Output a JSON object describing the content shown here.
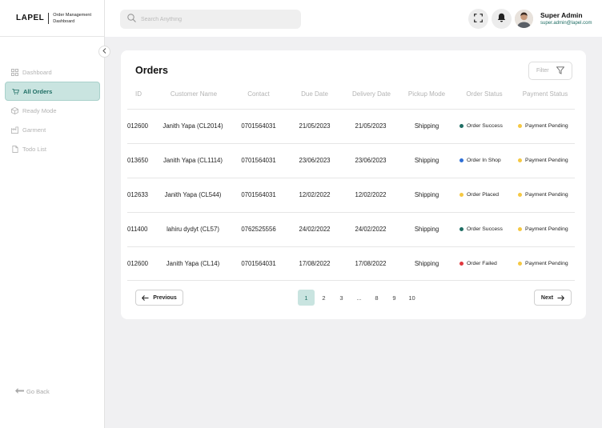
{
  "brand": {
    "name": "LAPEL",
    "subtitle": "Order Management Dashboard"
  },
  "sidebar": {
    "items": [
      {
        "label": "Dashboard",
        "icon": "grid-icon",
        "active": false
      },
      {
        "label": "All Orders",
        "icon": "cart-icon",
        "active": true
      },
      {
        "label": "Ready Mode",
        "icon": "box-icon",
        "active": false
      },
      {
        "label": "Garment",
        "icon": "factory-icon",
        "active": false
      },
      {
        "label": "Todo List",
        "icon": "document-icon",
        "active": false
      }
    ],
    "go_back": "Go Back"
  },
  "topbar": {
    "search_placeholder": "Search Anything",
    "user": {
      "name": "Super Admin",
      "email": "super.admin@lapel.com"
    }
  },
  "orders": {
    "title": "Orders",
    "filter_label": "Filter",
    "columns": [
      "ID",
      "Customer Name",
      "Contact",
      "Due Date",
      "Delivery Date",
      "Pickup Mode",
      "Order Status",
      "Payment Status"
    ],
    "rows": [
      {
        "id": "012600",
        "customer": "Janith Yapa (CL2014)",
        "contact": "0701564031",
        "due": "21/05/2023",
        "delivery": "21/05/2023",
        "pickup": "Shipping",
        "order_status": "Order Success",
        "order_color": "#1f6e64",
        "payment_status": "Payment Pending",
        "payment_color": "#f5c842"
      },
      {
        "id": "013650",
        "customer": "Janith Yapa (CL1114)",
        "contact": "0701564031",
        "due": "23/06/2023",
        "delivery": "23/06/2023",
        "pickup": "Shipping",
        "order_status": "Order In Shop",
        "order_color": "#2f6fd6",
        "payment_status": "Payment Pending",
        "payment_color": "#f5c842"
      },
      {
        "id": "012633",
        "customer": "Janith Yapa (CL544)",
        "contact": "0701564031",
        "due": "12/02/2022",
        "delivery": "12/02/2022",
        "pickup": "Shipping",
        "order_status": "Order Placed",
        "order_color": "#f5c842",
        "payment_status": "Payment Pending",
        "payment_color": "#f5c842"
      },
      {
        "id": "011400",
        "customer": "lahiru dydyt (CL57)",
        "contact": "0762525556",
        "due": "24/02/2022",
        "delivery": "24/02/2022",
        "pickup": "Shipping",
        "order_status": "Order Success",
        "order_color": "#1f6e64",
        "payment_status": "Payment Pending",
        "payment_color": "#f5c842"
      },
      {
        "id": "012600",
        "customer": "Janith Yapa (CL14)",
        "contact": "0701564031",
        "due": "17/08/2022",
        "delivery": "17/08/2022",
        "pickup": "Shipping",
        "order_status": "Order Failed",
        "order_color": "#e0383e",
        "payment_status": "Payment Pending",
        "payment_color": "#f5c842"
      }
    ]
  },
  "pagination": {
    "previous_label": "Previous",
    "next_label": "Next",
    "pages": [
      "1",
      "2",
      "3",
      "...",
      "8",
      "9",
      "10"
    ],
    "current": "1"
  }
}
